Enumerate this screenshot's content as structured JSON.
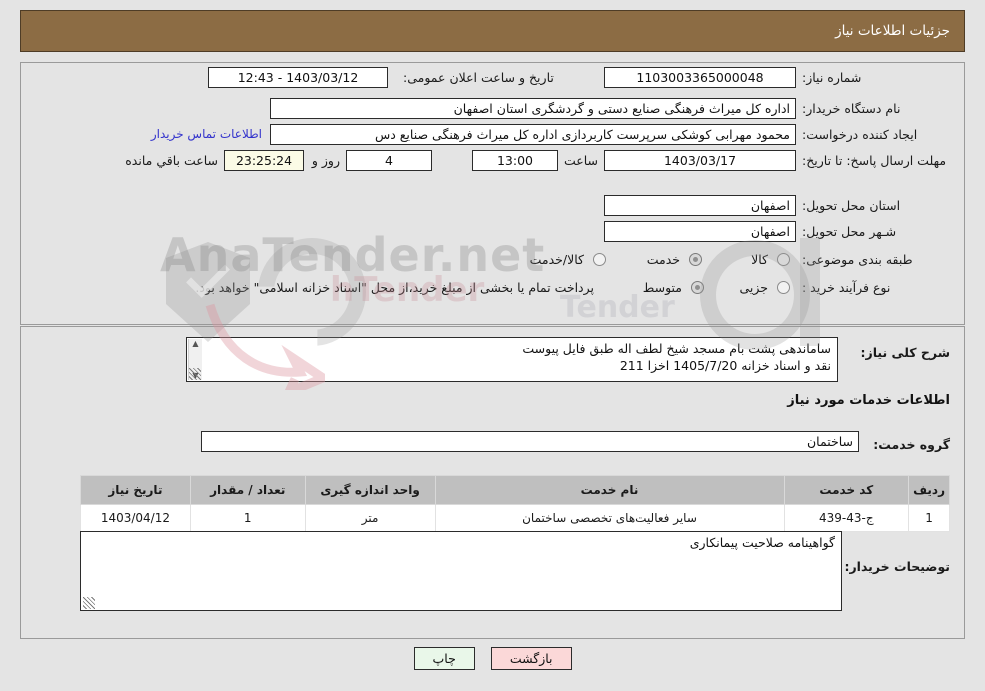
{
  "header": {
    "title": "جزئیات اطلاعات نیاز"
  },
  "fields": {
    "need_number": {
      "label": "شماره نیاز:",
      "value": "1103003365000048"
    },
    "public_announce": {
      "label": "تاریخ و ساعت اعلان عمومی:",
      "value": "1403/03/12 - 12:43"
    },
    "buyer_org": {
      "label": "نام دستگاه خریدار:",
      "value": "اداره کل میراث فرهنگی  صنایع دستی و گردشگری استان اصفهان"
    },
    "creator": {
      "label": "ایجاد کننده درخواست:",
      "value": "محمود مهرابی کوشکی سرپرست کاربردازی اداره کل میراث فرهنگی  صنایع دس"
    },
    "contact_link": "اطلاعات تماس خریدار",
    "deadline": {
      "label": "مهلت ارسال پاسخ: تا تاریخ:",
      "value": "1403/03/17"
    },
    "deadline_time": {
      "label": "ساعت",
      "value": "13:00"
    },
    "remaining_days": {
      "value": "4",
      "suffix": "روز و"
    },
    "remaining_time": {
      "value": "23:25:24",
      "suffix": "ساعت باقي مانده"
    },
    "province": {
      "label": "استان محل تحویل:",
      "value": "اصفهان"
    },
    "city": {
      "label": "شـهر محل تحویل:",
      "value": "اصفهان"
    },
    "category": {
      "label": "طبقه بندی موضوعی:",
      "options": [
        {
          "label": "کالا",
          "selected": false
        },
        {
          "label": "خدمت",
          "selected": true
        },
        {
          "label": "کالا/خدمت",
          "selected": false
        }
      ]
    },
    "purchase_type": {
      "label": "نوع فرآیند خرید :",
      "options": [
        {
          "label": "جزیی",
          "selected": false
        },
        {
          "label": "متوسط",
          "selected": true
        }
      ],
      "note": "پرداخت تمام یا بخشی از مبلغ خرید،از محل \"اسناد خزانه اسلامی\" خواهد بود."
    },
    "general_desc": {
      "label": "شرح کلی نیاز:",
      "line1": "ساماندهی پشت بام مسجد شیخ لطف اله طبق فایل پیوست",
      "line2": "نقد و اسناد خزانه 1405/7/20 اخزا 211"
    },
    "services_section_title": "اطلاعات خدمات مورد نیاز",
    "service_group": {
      "label": "گروه خدمت:",
      "value": "ساختمان"
    },
    "buyer_notes": {
      "label": "توضیحات خریدار:",
      "value": "گواهینامه صلاحیت پیمانکاری"
    }
  },
  "table": {
    "headers": [
      "ردیف",
      "کد خدمت",
      "نام خدمت",
      "واحد اندازه گیری",
      "تعداد / مقدار",
      "تاریخ نیاز"
    ],
    "rows": [
      {
        "radif": "1",
        "code": "ج-43-439",
        "name": "سایر فعالیت‌های تخصصی ساختمان",
        "unit": "متر",
        "qty": "1",
        "date": "1403/04/12"
      }
    ]
  },
  "footer": {
    "print_label": "چاپ",
    "back_label": "بازگشت"
  },
  "watermark": {
    "text1": "AnaTender.net",
    "text2": "hTender",
    "text3": "Tender"
  },
  "colors": {
    "header_bg": "#8c6c44",
    "page_bg": "#e4e4e4",
    "link": "#3333cc",
    "table_header_bg": "#bfbfbf",
    "btn_print_bg": "#e9f7e9",
    "btn_back_bg": "#fbd8d8",
    "timer_bg": "#fbfbe6"
  }
}
